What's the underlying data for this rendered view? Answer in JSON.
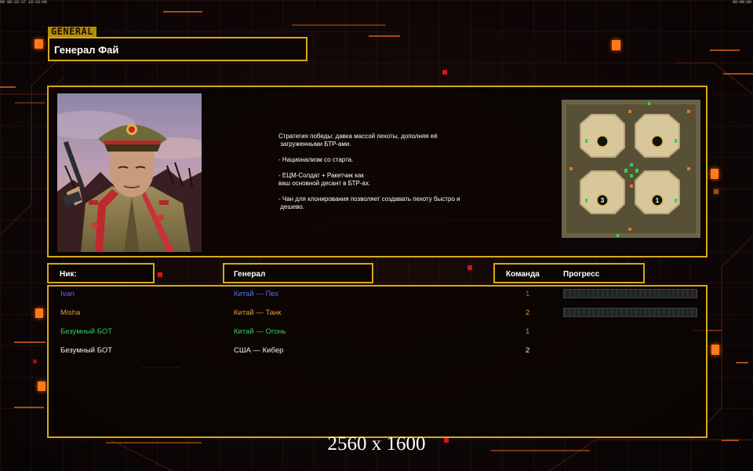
{
  "status_bar": {
    "left_text": "00 00:32:37 19:33:06",
    "right_text": "00:00:00"
  },
  "logo_text": "GENERAL",
  "general_name": "Генерал Фай",
  "description": "Стратегия победы: давка массой пехоты, дополняя её\n загруженными БТР-ами.\n\n- Национализм со старта.\n\n- ЕЦМ-Солдат + Ракетчик как\nваш основной десант в БТР-ах.\n\n- Чан для клонирования позволяет создавать пехоту быстро и\n дешево.",
  "map": {
    "start_positions": [
      "",
      "",
      "3",
      "1"
    ]
  },
  "headers": {
    "nick": "Ник:",
    "general": "Генерал",
    "team": "Команда",
    "progress": "Прогресс"
  },
  "players": [
    {
      "nick": "Ivan",
      "general": "Китай — Пех",
      "team": "1",
      "color": "#4a74e8",
      "has_progress": true,
      "progress": 0
    },
    {
      "nick": "Misha",
      "general": "Китай — Танк",
      "team": "2",
      "color": "#e49a3c",
      "has_progress": true,
      "progress": 0
    },
    {
      "nick": "Безумный БОТ",
      "general": "Китай — Огонь",
      "team": "1",
      "color": "#2fd05a",
      "has_progress": false
    },
    {
      "nick": "Безумный БОТ",
      "general": "США — Кибер",
      "team": "2",
      "color": "#f0f0f0",
      "has_progress": false
    }
  ],
  "watermark": "2560 x 1600",
  "colors": {
    "frame": "#d9a912",
    "accent_orange": "#ff7a1a",
    "background": "#0b0606"
  }
}
